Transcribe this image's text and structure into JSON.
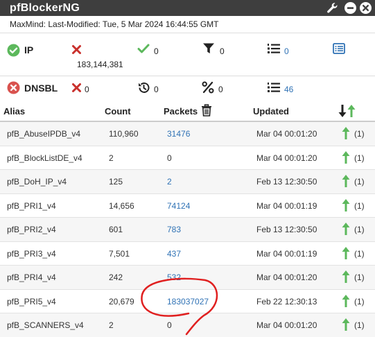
{
  "window": {
    "title": "pfBlockerNG"
  },
  "maxmind": {
    "text": "MaxMind: Last-Modified: Tue, 5 Mar 2024 16:44:55 GMT"
  },
  "ip_stats": {
    "label": "IP",
    "failed_count": "183,144,381",
    "ok_count": "0",
    "filter_count": "0",
    "list_count": "0"
  },
  "dnsbl_stats": {
    "label": "DNSBL",
    "failed_count": "0",
    "history_count": "0",
    "percent_count": "0",
    "list_count": "46"
  },
  "table": {
    "headers": {
      "alias": "Alias",
      "count": "Count",
      "packets": "Packets",
      "updated": "Updated"
    },
    "rows": [
      {
        "alias": "pfB_AbuseIPDB_v4",
        "count": "110,960",
        "packets": "31476",
        "packets_link": true,
        "updated": "Mar 04 00:01:20",
        "rule_count": "(1)"
      },
      {
        "alias": "pfB_BlockListDE_v4",
        "count": "2",
        "packets": "0",
        "packets_link": false,
        "updated": "Mar 04 00:01:20",
        "rule_count": "(1)"
      },
      {
        "alias": "pfB_DoH_IP_v4",
        "count": "125",
        "packets": "2",
        "packets_link": true,
        "updated": "Feb 13 12:30:50",
        "rule_count": "(1)"
      },
      {
        "alias": "pfB_PRI1_v4",
        "count": "14,656",
        "packets": "74124",
        "packets_link": true,
        "updated": "Mar 04 00:01:19",
        "rule_count": "(1)"
      },
      {
        "alias": "pfB_PRI2_v4",
        "count": "601",
        "packets": "783",
        "packets_link": true,
        "updated": "Feb 13 12:30:50",
        "rule_count": "(1)"
      },
      {
        "alias": "pfB_PRI3_v4",
        "count": "7,501",
        "packets": "437",
        "packets_link": true,
        "updated": "Mar 04 00:01:19",
        "rule_count": "(1)"
      },
      {
        "alias": "pfB_PRI4_v4",
        "count": "242",
        "packets": "532",
        "packets_link": true,
        "updated": "Mar 04 00:01:20",
        "rule_count": "(1)"
      },
      {
        "alias": "pfB_PRI5_v4",
        "count": "20,679",
        "packets": "183037027",
        "packets_link": true,
        "updated": "Feb 22 12:30:13",
        "rule_count": "(1)"
      },
      {
        "alias": "pfB_SCANNERS_v4",
        "count": "2",
        "packets": "0",
        "packets_link": false,
        "updated": "Mar 04 00:01:20",
        "rule_count": "(1)"
      }
    ]
  },
  "colors": {
    "titlebar": "#3e3e3e",
    "link": "#2f72b5",
    "success": "#5cb85c",
    "danger": "#d9534f",
    "annotation": "#e02020"
  },
  "icons": {
    "titlebar": [
      "wrench-icon",
      "minimize-icon",
      "close-icon"
    ],
    "ip_row": [
      "check-circle-icon",
      "times-icon",
      "check-icon",
      "filter-icon",
      "list-ol-icon",
      "list-alt-icon"
    ],
    "dnsbl_row": [
      "times-circle-icon",
      "times-icon",
      "history-icon",
      "percent-icon",
      "list-ol-icon"
    ],
    "table_header": [
      "trash-icon",
      "sort-arrows-icon"
    ],
    "row": [
      "arrow-up-icon"
    ]
  }
}
